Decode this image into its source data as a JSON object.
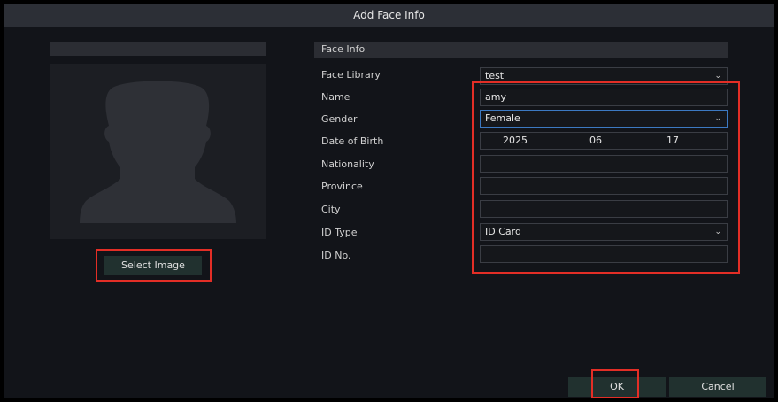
{
  "dialog": {
    "title": "Add Face Info"
  },
  "photo": {
    "select_image_label": "Select Image",
    "placeholder_icon": "person-silhouette-icon"
  },
  "form": {
    "section_title": "Face Info",
    "face_library": {
      "label": "Face Library",
      "value": "test"
    },
    "name": {
      "label": "Name",
      "value": "amy"
    },
    "gender": {
      "label": "Gender",
      "value": "Female"
    },
    "date_of_birth": {
      "label": "Date of Birth",
      "year": "2025",
      "month": "06",
      "day": "17"
    },
    "nationality": {
      "label": "Nationality",
      "value": ""
    },
    "province": {
      "label": "Province",
      "value": ""
    },
    "city": {
      "label": "City",
      "value": ""
    },
    "id_type": {
      "label": "ID Type",
      "value": "ID Card"
    },
    "id_no": {
      "label": "ID No.",
      "value": ""
    }
  },
  "footer": {
    "ok_label": "OK",
    "cancel_label": "Cancel"
  },
  "colors": {
    "background": "#121419",
    "titlebar": "#2c2f36",
    "button": "#21312f",
    "highlight": "#e32e26",
    "active_border": "#3c79c2"
  }
}
